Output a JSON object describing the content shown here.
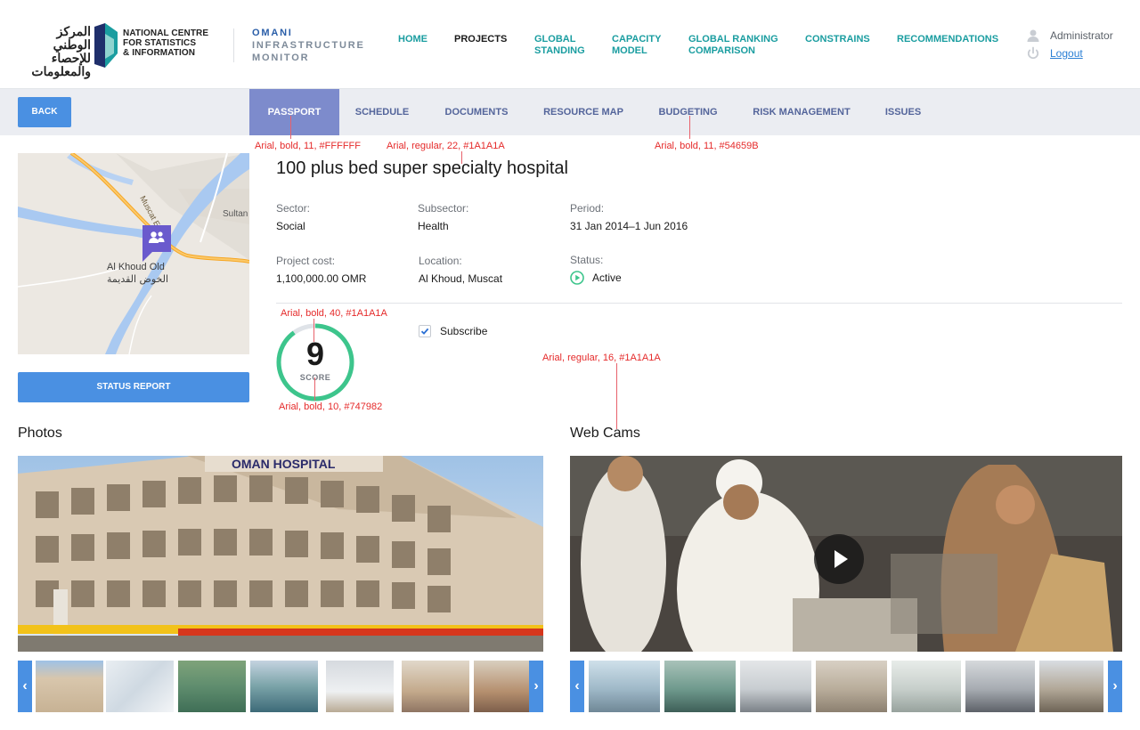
{
  "header": {
    "logo": {
      "arabic_lines": [
        "المركز الوطني",
        "للإحصاء",
        "والمعلومات"
      ],
      "english_lines": [
        "NATIONAL CENTRE",
        "FOR STATISTICS",
        "& INFORMATION"
      ]
    },
    "brand_lines": [
      "OMANI",
      "INFRASTRUCTURE",
      "MONITOR"
    ],
    "nav": [
      {
        "label_lines": [
          "HOME"
        ],
        "active": false
      },
      {
        "label_lines": [
          "PROJECTS"
        ],
        "active": true
      },
      {
        "label_lines": [
          "GLOBAL",
          "STANDING"
        ],
        "active": false
      },
      {
        "label_lines": [
          "CAPACITY",
          "MODEL"
        ],
        "active": false
      },
      {
        "label_lines": [
          "GLOBAL RANKING",
          "COMPARISON"
        ],
        "active": false
      },
      {
        "label_lines": [
          "CONSTRAINS"
        ],
        "active": false
      },
      {
        "label_lines": [
          "RECOMMENDATIONS"
        ],
        "active": false
      }
    ],
    "user": {
      "name": "Administrator",
      "logout_label": "Logout"
    }
  },
  "tabbar": {
    "back_label": "BACK",
    "tabs": [
      {
        "label": "PASSPORT",
        "active": true
      },
      {
        "label": "SCHEDULE",
        "active": false
      },
      {
        "label": "DOCUMENTS",
        "active": false
      },
      {
        "label": "RESOURCE MAP",
        "active": false
      },
      {
        "label": "BUDGETING",
        "active": false
      },
      {
        "label": "RISK MANAGEMENT",
        "active": false
      },
      {
        "label": "ISSUES",
        "active": false
      }
    ]
  },
  "map": {
    "place_en": "Al Khoud Old",
    "place_ar": "الخوض القديمة",
    "road_label": "Muscat Exp",
    "town_label": "Sultan",
    "marker_icon": "people-icon"
  },
  "sidebar": {
    "status_report_label": "STATUS REPORT"
  },
  "project": {
    "title": "100 plus bed super specialty hospital",
    "fields": {
      "sector": {
        "label": "Sector:",
        "value": "Social"
      },
      "subsector": {
        "label": "Subsector:",
        "value": "Health"
      },
      "period": {
        "label": "Period:",
        "value": "31 Jan 2014–1 Jun 2016"
      },
      "cost": {
        "label": "Project cost:",
        "value": "1,100,000.00 OMR"
      },
      "location": {
        "label": "Location:",
        "value": "Al Khoud, Muscat"
      },
      "status": {
        "label": "Status:",
        "value": "Active"
      }
    },
    "score": {
      "value": "9",
      "label": "SCORE",
      "fraction": 0.9
    },
    "subscribe": {
      "label": "Subscribe",
      "checked": true
    }
  },
  "annotations": [
    "Arial, bold, 11, #FFFFFF",
    "Arial, regular, 22, #1A1A1A",
    "Arial, bold, 11, #54659B",
    "Arial, bold, 40, #1A1A1A",
    "Arial, regular, 16, #1A1A1A",
    "Arial, bold, 10, #747982"
  ],
  "photos": {
    "title": "Photos",
    "building_sign": "OMAN HOSPITAL",
    "thumb_count": 7
  },
  "webcams": {
    "title": "Web Cams",
    "thumb_count": 7
  },
  "colors": {
    "accent_blue": "#4a90e2",
    "nav_teal": "#1a9da0",
    "tab_text": "#54659B",
    "tab_active_bg": "#7d8bcc",
    "score_ring": "#3dc58c",
    "annotation_red": "#e52a2a"
  }
}
